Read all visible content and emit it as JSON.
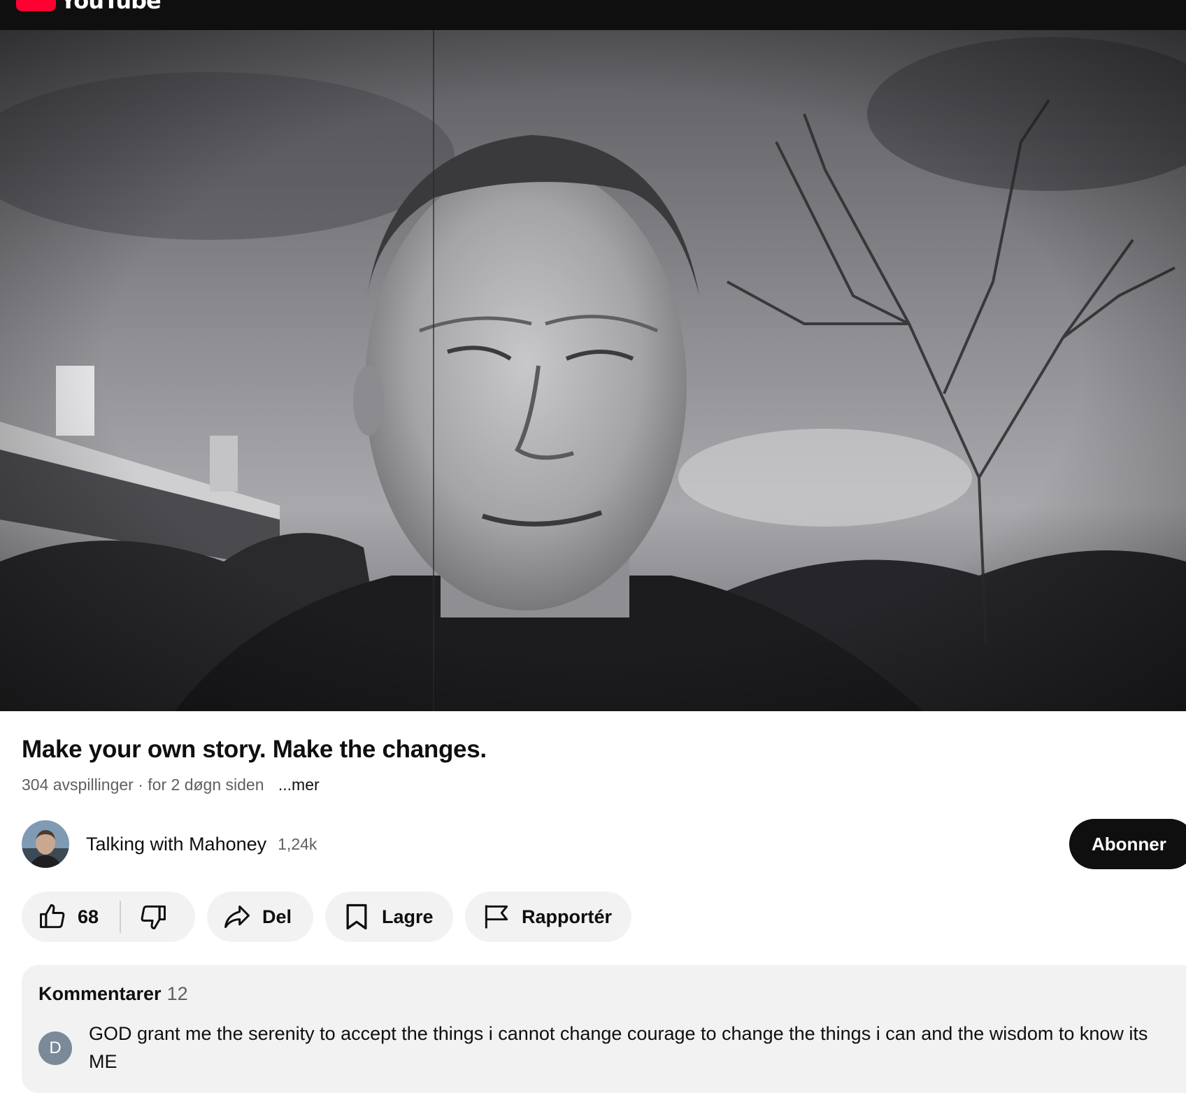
{
  "header": {
    "brand": "YouTube"
  },
  "video": {
    "title": "Make your own story. Make the changes.",
    "views": "304 avspillinger",
    "separator": "·",
    "age": "for 2 døgn siden",
    "more": "...mer"
  },
  "channel": {
    "name": "Talking with Mahoney",
    "subscribers": "1,24k",
    "subscribe_label": "Abonner"
  },
  "actions": {
    "like_count": "68",
    "share_label": "Del",
    "save_label": "Lagre",
    "report_label": "Rapportér"
  },
  "comments": {
    "label": "Kommentarer",
    "count": "12",
    "top_comment": {
      "avatar_letter": "D",
      "text": "GOD grant me the serenity to accept the things i cannot change  courage to change the things i can and the wisdom to know its ME"
    }
  },
  "colors": {
    "brand_red": "#ff0033",
    "topbar": "#0f0f0f",
    "pill_bg": "#f2f2f2",
    "subscribe_bg": "#0f0f0f",
    "comment_avatar": "#7a8a99"
  },
  "icons": [
    "youtube-logo-icon",
    "like-icon",
    "dislike-icon",
    "share-icon",
    "save-icon",
    "report-icon"
  ]
}
